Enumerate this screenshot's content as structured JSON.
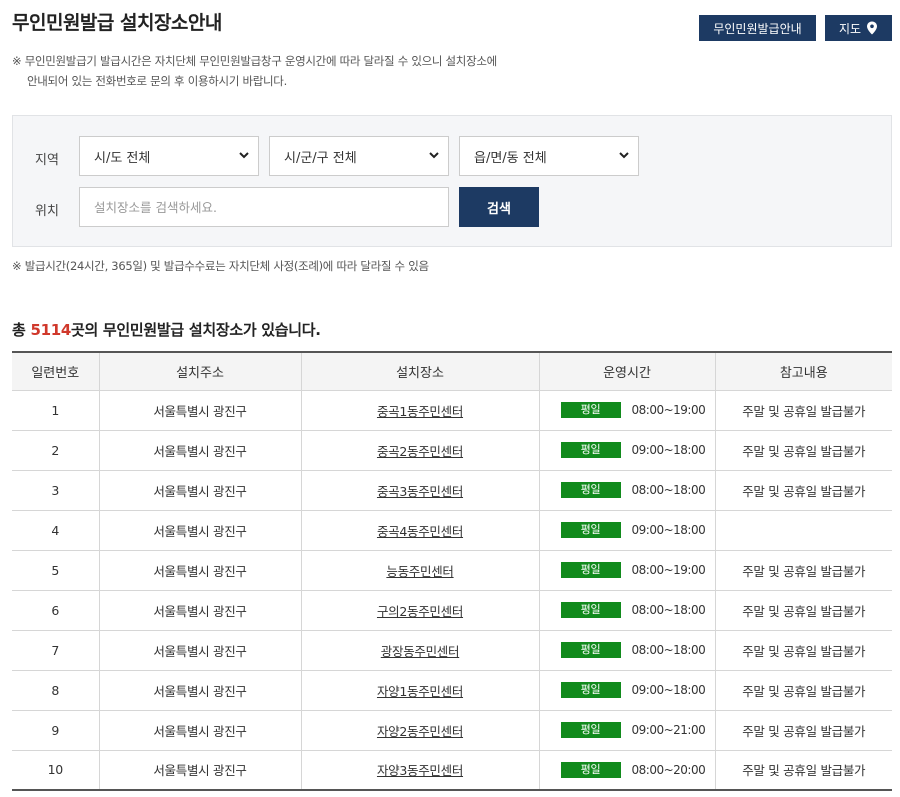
{
  "header": {
    "title": "무인민원발급 설치장소안내",
    "guide_button": "무인민원발급안내",
    "map_button": "지도"
  },
  "notice": {
    "line1": "※ 무인민원발급기 발급시간은 자치단체 무인민원발급창구 운영시간에 따라 달라질 수 있으니 설치장소에",
    "line2": "안내되어 있는 전화번호로 문의 후 이용하시기 바랍니다."
  },
  "search": {
    "region_label": "지역",
    "location_label": "위치",
    "sido_selected": "시/도 전체",
    "sigungu_selected": "시/군/구 전체",
    "eupmyeondong_selected": "읍/면/동 전체",
    "placeholder": "설치장소를 검색하세요.",
    "button": "검색"
  },
  "notice2": "※ 발급시간(24시간, 365일) 및 발급수수료는 자치단체 사정(조례)에 따라 달라질 수 있음",
  "summary": {
    "prefix": "총 ",
    "count": "5114",
    "suffix": "곳의 무인민원발급 설치장소가 있습니다."
  },
  "table": {
    "headers": [
      "일련번호",
      "설치주소",
      "설치장소",
      "운영시간",
      "참고내용"
    ],
    "rows": [
      {
        "no": "1",
        "address": "서울특별시 광진구",
        "place": "중곡1동주민센터",
        "day": "평일",
        "hours": "08:00~19:00",
        "note": "주말 및 공휴일 발급불가"
      },
      {
        "no": "2",
        "address": "서울특별시 광진구",
        "place": "중곡2동주민센터",
        "day": "평일",
        "hours": "09:00~18:00",
        "note": "주말 및 공휴일 발급불가"
      },
      {
        "no": "3",
        "address": "서울특별시 광진구",
        "place": "중곡3동주민센터",
        "day": "평일",
        "hours": "08:00~18:00",
        "note": "주말 및 공휴일 발급불가"
      },
      {
        "no": "4",
        "address": "서울특별시 광진구",
        "place": "중곡4동주민센터",
        "day": "평일",
        "hours": "09:00~18:00",
        "note": ""
      },
      {
        "no": "5",
        "address": "서울특별시 광진구",
        "place": "능동주민센터",
        "day": "평일",
        "hours": "08:00~19:00",
        "note": "주말 및 공휴일 발급불가"
      },
      {
        "no": "6",
        "address": "서울특별시 광진구",
        "place": "구의2동주민센터",
        "day": "평일",
        "hours": "08:00~18:00",
        "note": "주말 및 공휴일 발급불가"
      },
      {
        "no": "7",
        "address": "서울특별시 광진구",
        "place": "광장동주민센터",
        "day": "평일",
        "hours": "08:00~18:00",
        "note": "주말 및 공휴일 발급불가"
      },
      {
        "no": "8",
        "address": "서울특별시 광진구",
        "place": "자양1동주민센터",
        "day": "평일",
        "hours": "09:00~18:00",
        "note": "주말 및 공휴일 발급불가"
      },
      {
        "no": "9",
        "address": "서울특별시 광진구",
        "place": "자양2동주민센터",
        "day": "평일",
        "hours": "09:00~21:00",
        "note": "주말 및 공휴일 발급불가"
      },
      {
        "no": "10",
        "address": "서울특별시 광진구",
        "place": "자양3동주민센터",
        "day": "평일",
        "hours": "08:00~20:00",
        "note": "주말 및 공휴일 발급불가"
      }
    ]
  },
  "colors": {
    "primary": "#1d3a63",
    "badge": "#118a1c",
    "count": "#d0382b"
  }
}
